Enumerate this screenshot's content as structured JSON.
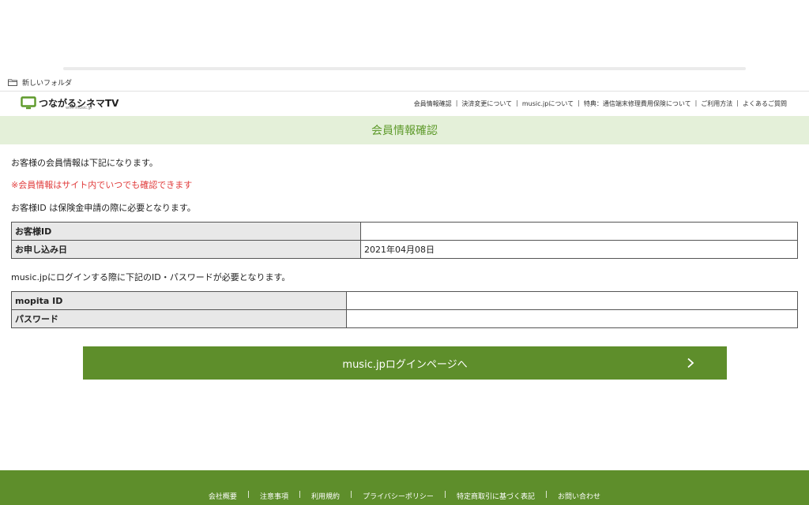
{
  "bookmarks": {
    "folder_label": "新しいフォルダ"
  },
  "header": {
    "logo_text": "つながるシネマTV",
    "logo_sub": "with music.jp",
    "nav": [
      "会員情報確認",
      "決済変更について",
      "music.jpについて",
      "特典：通信端末修理費用保険について",
      "ご利用方法",
      "よくあるご質問"
    ]
  },
  "page": {
    "title": "会員情報確認",
    "intro": "お客様の会員情報は下記になります。",
    "notice": "※会員情報はサイト内でいつでも確認できます",
    "id_note": "お客様ID は保険金申請の際に必要となります。",
    "login_note": "music.jpにログインする際に下記のID・パスワードが必要となります。"
  },
  "member_table": {
    "rows": [
      {
        "label": "お客様ID",
        "value": ""
      },
      {
        "label": "お申し込み日",
        "value": "2021年04月08日"
      }
    ]
  },
  "login_table": {
    "rows": [
      {
        "label": "mopita ID",
        "value": ""
      },
      {
        "label": "パスワード",
        "value": ""
      }
    ]
  },
  "login_button": {
    "label": "music.jpログインページへ"
  },
  "footer": {
    "links": [
      "会社概要",
      "注意事項",
      "利用規約",
      "プライバシーポリシー",
      "特定商取引に基づく表記",
      "お問い合わせ"
    ]
  },
  "colors": {
    "brand_green": "#5e8e2b",
    "band_green": "#e4f0d9",
    "title_green": "#5e9a2b",
    "notice_red": "#e03a3a"
  },
  "icons": {
    "folder": "folder-icon",
    "logo": "tv-icon",
    "button": "chevron-right-icon"
  }
}
